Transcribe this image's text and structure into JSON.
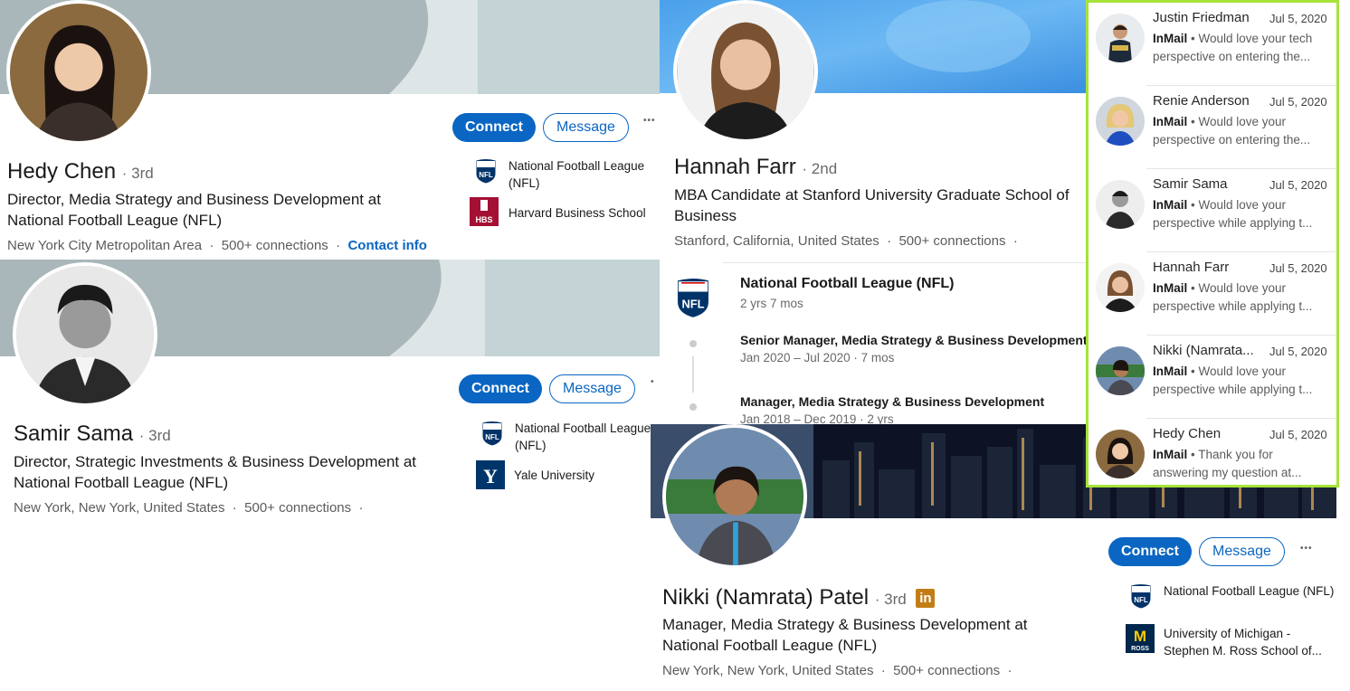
{
  "colors": {
    "primary": "#0a66c2",
    "highlight": "#a6e33a",
    "nfl_blue": "#013369",
    "nfl_red": "#d50a0a",
    "hbs": "#a41034",
    "yale": "#00356b",
    "umich": "#00274c",
    "maize": "#ffcb05",
    "linkedin_badge": "#c37d16"
  },
  "hedy": {
    "name": "Hedy Chen",
    "degree": "3rd",
    "headline": "Director, Media Strategy and Business Development at National Football League (NFL)",
    "location": "New York City Metropolitan Area",
    "connections": "500+ connections",
    "contact": "Contact info",
    "connect": "Connect",
    "message": "Message",
    "orgs": [
      {
        "name": "National Football League (NFL)",
        "icon": "nfl-shield-icon"
      },
      {
        "name": "Harvard Business School",
        "icon": "hbs-shield-icon"
      }
    ]
  },
  "samir": {
    "name": "Samir Sama",
    "degree": "3rd",
    "headline": "Director, Strategic Investments & Business Development at National Football League (NFL)",
    "location": "New York, New York, United States",
    "connections": "500+ connections",
    "connect": "Connect",
    "message": "Message",
    "orgs": [
      {
        "name": "National Football League (NFL)",
        "icon": "nfl-shield-icon"
      },
      {
        "name": "Yale University",
        "icon": "yale-y-icon"
      }
    ]
  },
  "hannah": {
    "name": "Hannah Farr",
    "degree": "2nd",
    "headline": "MBA Candidate at Stanford University Graduate School of Business",
    "location": "Stanford, California, United States",
    "connections": "500+ connections",
    "experience": {
      "company": "National Football League (NFL)",
      "duration": "2 yrs 7 mos",
      "roles": [
        {
          "title": "Senior Manager, Media Strategy & Business Development",
          "dates": "Jan 2020 – Jul 2020 · 7 mos"
        },
        {
          "title": "Manager, Media Strategy & Business Development",
          "dates": "Jan 2018 – Dec 2019 · 2 yrs"
        }
      ]
    }
  },
  "nikki": {
    "name": "Nikki (Namrata) Patel",
    "degree": "3rd",
    "badge": "in",
    "headline": "Manager, Media Strategy & Business Development at National Football League (NFL)",
    "location": "New York, New York, United States",
    "connections": "500+ connections",
    "connect": "Connect",
    "message": "Message",
    "orgs": [
      {
        "name": "National Football League (NFL)",
        "icon": "nfl-shield-icon"
      },
      {
        "name": "University of Michigan - Stephen M. Ross School of...",
        "icon": "umich-ross-icon"
      }
    ]
  },
  "inbox": [
    {
      "name": "Justin Friedman",
      "date": "Jul 5, 2020",
      "tag": "InMail",
      "text": "Would love your tech perspective on entering the..."
    },
    {
      "name": "Renie Anderson",
      "date": "Jul 5, 2020",
      "tag": "InMail",
      "text": "Would love your perspective on entering the..."
    },
    {
      "name": "Samir Sama",
      "date": "Jul 5, 2020",
      "tag": "InMail",
      "text": "Would love your perspective while applying t..."
    },
    {
      "name": "Hannah Farr",
      "date": "Jul 5, 2020",
      "tag": "InMail",
      "text": "Would love your perspective while applying t..."
    },
    {
      "name": "Nikki (Namrata...",
      "date": "Jul 5, 2020",
      "tag": "InMail",
      "text": "Would love your perspective while applying t..."
    },
    {
      "name": "Hedy Chen",
      "date": "Jul 5, 2020",
      "tag": "InMail",
      "text": "Thank you for answering my question at..."
    }
  ],
  "logo_text": {
    "nfl": "NFL",
    "hbs": "HBS",
    "yale": "Y",
    "umich": "M",
    "ross": "ROSS"
  },
  "separator": "·",
  "more": "•••"
}
